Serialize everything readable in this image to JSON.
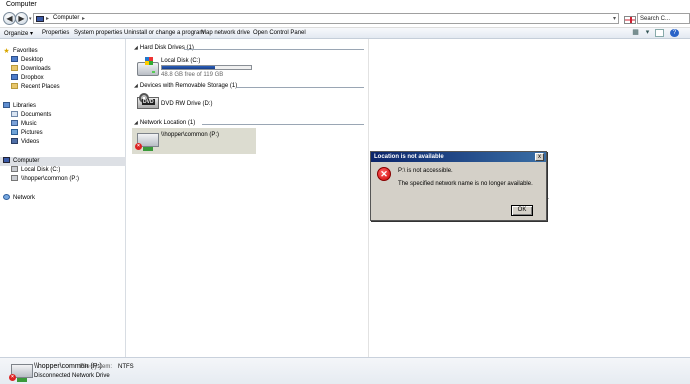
{
  "window": {
    "title": "Computer"
  },
  "address_bar": {
    "location": "Computer",
    "search_placeholder": "Search C..."
  },
  "toolbar": {
    "items": [
      "Organize",
      "Properties",
      "System properties",
      "Uninstall or change a program",
      "Map network drive",
      "Open Control Panel"
    ],
    "organize_arrow": "▾"
  },
  "navigation": {
    "favorites": {
      "label": "Favorites",
      "items": [
        "Desktop",
        "Downloads",
        "Dropbox",
        "Recent Places"
      ]
    },
    "libraries": {
      "label": "Libraries",
      "items": [
        "Documents",
        "Music",
        "Pictures",
        "Videos"
      ]
    },
    "computer": {
      "label": "Computer",
      "items": [
        "Local Disk (C:)",
        "\\\\hopper\\common (P:)"
      ]
    },
    "network": {
      "label": "Network"
    }
  },
  "content": {
    "groups": {
      "hard_disk": "Hard Disk Drives (1)",
      "removable": "Devices with Removable Storage (1)",
      "network": "Network Location (1)"
    },
    "local_disk": {
      "name": "Local Disk (C:)",
      "free": "48.8 GB free of 119 GB",
      "used_fraction": 0.59
    },
    "dvd": {
      "name": "DVD RW Drive (D:)",
      "badge": "DVD"
    },
    "network_drive": {
      "name": "\\\\hopper\\common (P:)"
    },
    "ghost_text": "e."
  },
  "dialog": {
    "title": "Location is not available",
    "close": "x",
    "message1": "P:\\ is not accessible.",
    "message2": "The specified network name is no longer available.",
    "ok_label": "OK"
  },
  "status": {
    "name": "\\\\hopper\\common (P:)",
    "fs_label": "File system:",
    "fs_value": "NTFS",
    "sub": "Disconnected Network Drive"
  }
}
